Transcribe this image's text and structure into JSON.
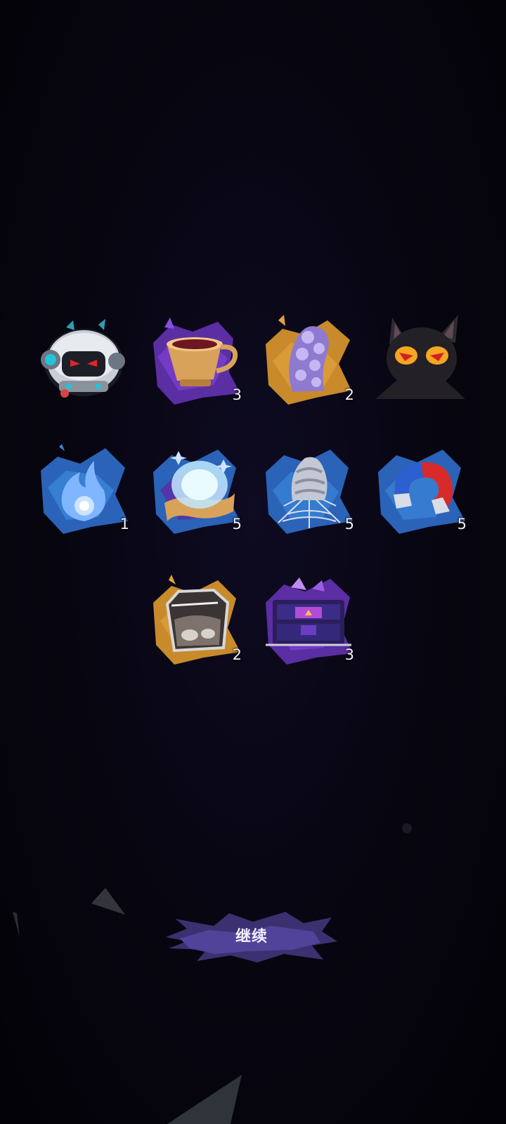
{
  "screen": "reward-items",
  "items": [
    {
      "name": "robot-drone",
      "count": null,
      "frame": "none"
    },
    {
      "name": "tea-cup",
      "count": "3",
      "frame": "purple"
    },
    {
      "name": "tentacle",
      "count": "2",
      "frame": "orange"
    },
    {
      "name": "black-cat",
      "count": null,
      "frame": "none"
    },
    {
      "name": "blue-flame",
      "count": "1",
      "frame": "blue"
    },
    {
      "name": "magic-scroll",
      "count": "5",
      "frame": "purple"
    },
    {
      "name": "spider-web",
      "count": "5",
      "frame": "blue"
    },
    {
      "name": "magnet",
      "count": "5",
      "frame": "blue"
    },
    {
      "name": "glass-jar",
      "count": "2",
      "frame": "orange"
    },
    {
      "name": "purple-chest",
      "count": "3",
      "frame": "purple"
    }
  ],
  "continue_button": {
    "label": "继续"
  },
  "colors": {
    "background": "#05030c",
    "frame_purple": "#5b2ea3",
    "frame_blue": "#2a63b8",
    "frame_orange": "#c98a2c",
    "button": "#4a3b86"
  }
}
